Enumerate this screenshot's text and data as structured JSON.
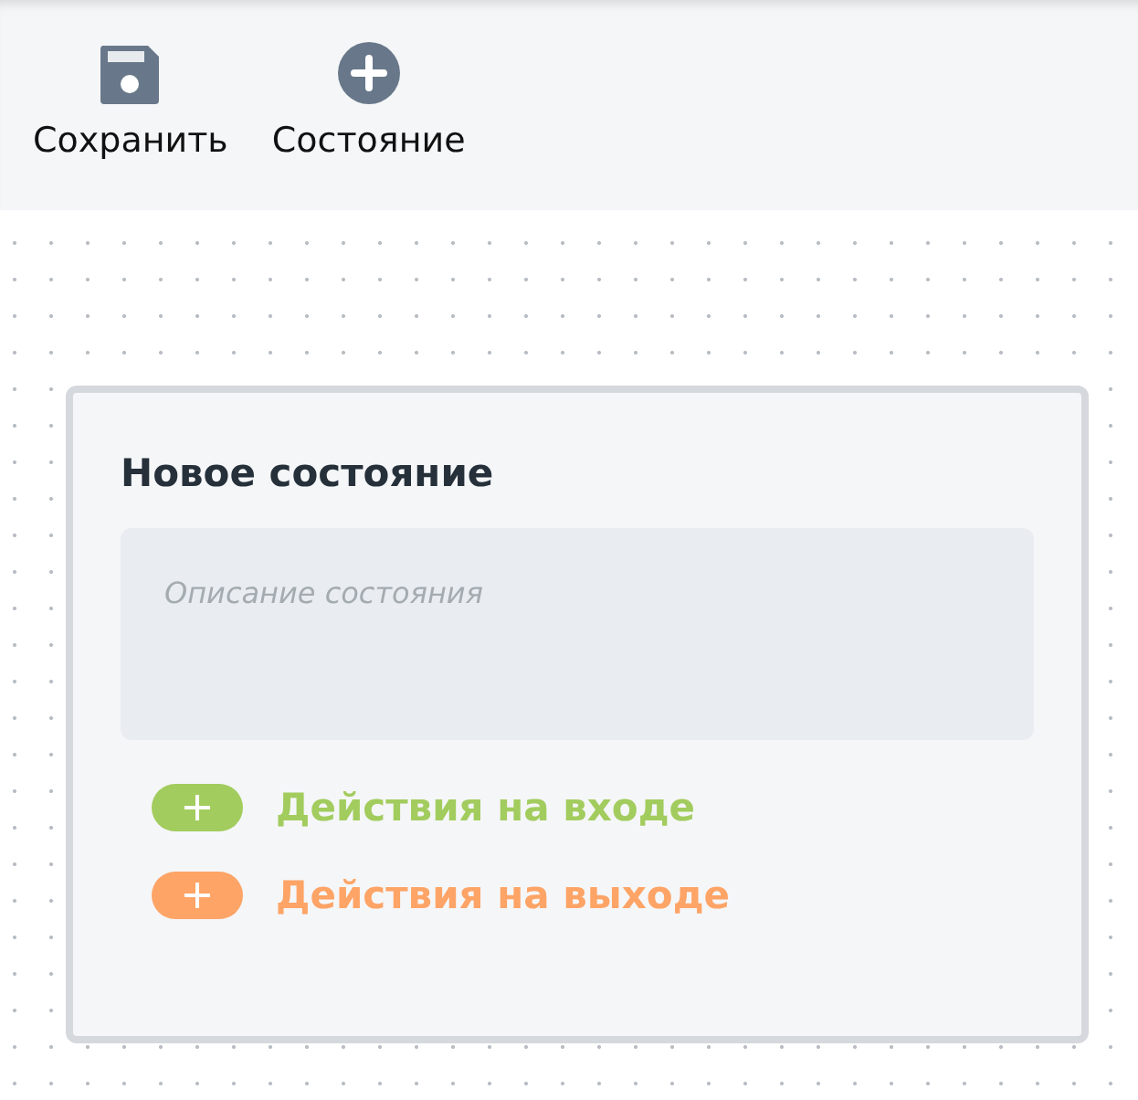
{
  "toolbar": [
    {
      "kind": "save",
      "label": "Сохранить"
    },
    {
      "kind": "add",
      "label": "Состояние"
    }
  ],
  "state_card": {
    "title": "Новое состояние",
    "description": {
      "placeholder": "Описание состояния"
    },
    "actions": [
      {
        "label": "Действия на входе",
        "color": "#a2cc5e"
      },
      {
        "label": "Действия на выходе",
        "color": "#fda466"
      }
    ]
  }
}
